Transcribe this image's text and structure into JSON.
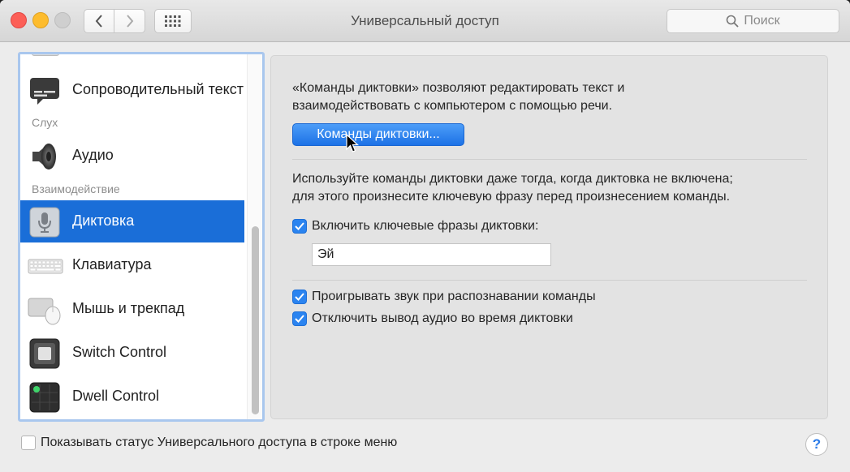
{
  "window": {
    "title": "Универсальный доступ"
  },
  "toolbar": {
    "search_placeholder": "Поиск"
  },
  "sidebar": {
    "sections": {
      "hearing": "Слух",
      "interaction": "Взаимодействие"
    },
    "items": [
      {
        "label": "Сопроводительный текст",
        "icon": "captions-icon"
      },
      {
        "label": "Аудио",
        "icon": "speaker-icon"
      },
      {
        "label": "Диктовка",
        "icon": "microphone-icon",
        "selected": true
      },
      {
        "label": "Клавиатура",
        "icon": "keyboard-icon"
      },
      {
        "label": "Мышь и трекпад",
        "icon": "mouse-icon"
      },
      {
        "label": "Switch Control",
        "icon": "switch-control-icon"
      },
      {
        "label": "Dwell Control",
        "icon": "dwell-control-icon"
      }
    ]
  },
  "content": {
    "intro_line1": "«Команды диктовки» позволяют редактировать текст и",
    "intro_line2": "взаимодействовать с компьютером с помощью речи.",
    "commands_button": "Команды диктовки...",
    "hint_line1": "Используйте команды диктовки даже тогда, когда диктовка не включена;",
    "hint_line2": "для этого произнесите ключевую фразу перед произнесением команды.",
    "enable_keyphrase_label": "Включить ключевые фразы диктовки:",
    "enable_keyphrase_checked": true,
    "keyphrase_value": "Эй",
    "play_sound_label": "Проигрывать звук при распознавании команды",
    "play_sound_checked": true,
    "mute_audio_label": "Отключить вывод аудио во время диктовки",
    "mute_audio_checked": true
  },
  "footer": {
    "menu_status_label": "Показывать статус Универсального доступа в строке меню",
    "menu_status_checked": false,
    "help_label": "?"
  },
  "colors": {
    "accent": "#1a6ed8",
    "checkbox": "#2b84f0"
  }
}
